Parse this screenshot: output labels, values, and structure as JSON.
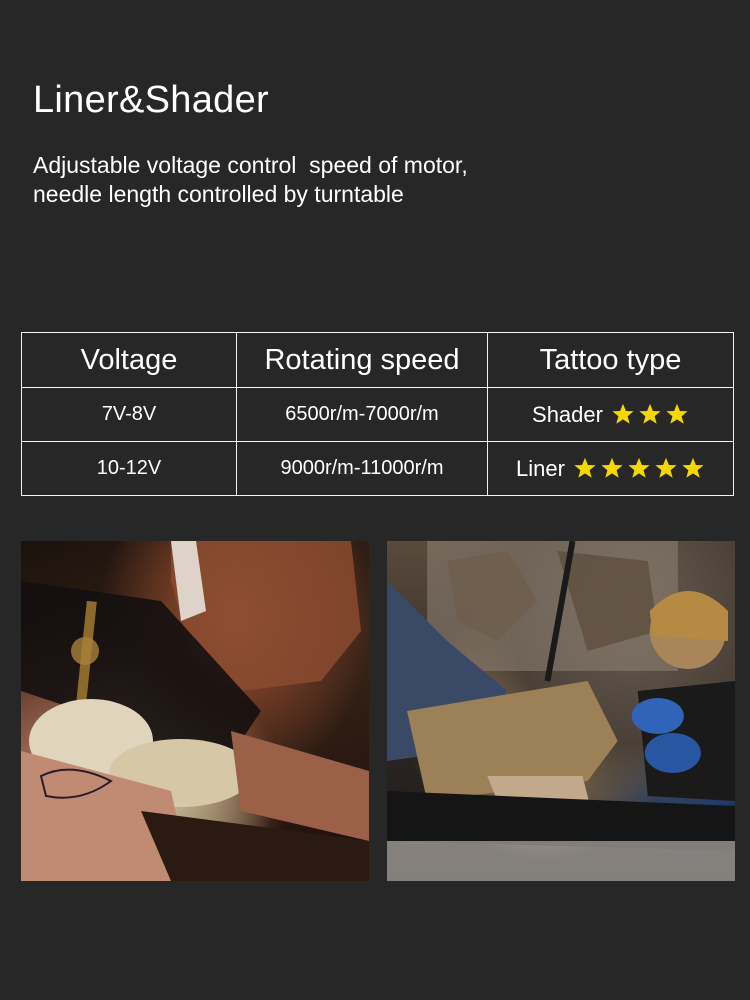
{
  "heading": {
    "title": "Liner&Shader",
    "description_lines": [
      "Adjustable voltage control  speed of motor,",
      "needle length controlled by turntable"
    ]
  },
  "spec_table": {
    "headers": [
      "Voltage",
      "Rotating speed",
      "Tattoo type"
    ],
    "rows": [
      {
        "voltage": "7V-8V",
        "speed": "6500r/m-7000r/m",
        "type": "Shader",
        "rating": 3
      },
      {
        "voltage": "10-12V",
        "speed": "9000r/m-11000r/m",
        "type": "Liner",
        "rating": 5
      }
    ]
  },
  "colors": {
    "background": "#272727",
    "text": "#ffffff",
    "star": "#f5d800"
  },
  "images": [
    {
      "name": "tattoo-artist-closeup-photo"
    },
    {
      "name": "tattoo-studio-session-photo"
    }
  ]
}
